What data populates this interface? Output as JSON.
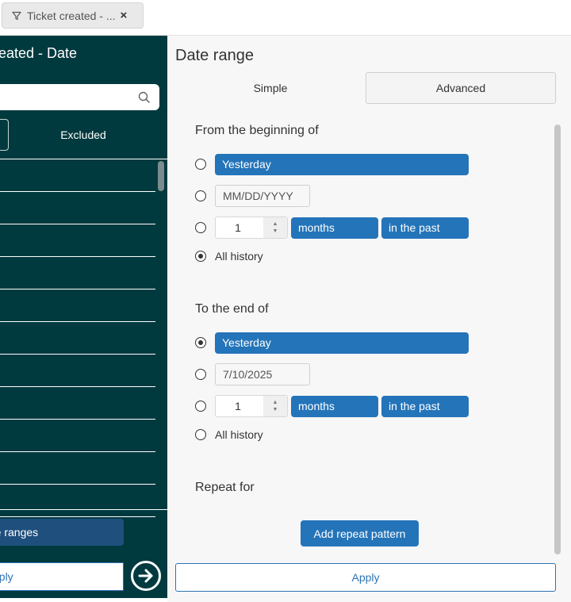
{
  "filter_chip": {
    "label": "Ticket created - ...",
    "close": "×"
  },
  "left_panel": {
    "title": "eated - Date",
    "search": {
      "value": "",
      "placeholder": ""
    },
    "tabs": {
      "excluded": "Excluded"
    },
    "list_rows": 11,
    "date_ranges_button": "ate ranges",
    "apply_button": "pply"
  },
  "right_panel": {
    "title": "Date range",
    "tabs": {
      "simple": "Simple",
      "advanced": "Advanced"
    },
    "from": {
      "title": "From the beginning of",
      "yesterday": "Yesterday",
      "date_placeholder": "MM/DD/YYYY",
      "date_value": "",
      "count": "1",
      "unit": "months",
      "direction": "in the past",
      "all_history": "All history",
      "selected": "all_history"
    },
    "to": {
      "title": "To the end of",
      "yesterday": "Yesterday",
      "date_value": "7/10/2025",
      "count": "1",
      "unit": "months",
      "direction": "in the past",
      "all_history": "All history",
      "selected": "yesterday"
    },
    "repeat": {
      "title": "Repeat for",
      "button": "Add repeat pattern"
    },
    "apply_button": "Apply"
  },
  "colors": {
    "left_panel_bg": "#003a3f",
    "accent_blue": "#2474b9",
    "apply_border": "#2d73b5"
  }
}
